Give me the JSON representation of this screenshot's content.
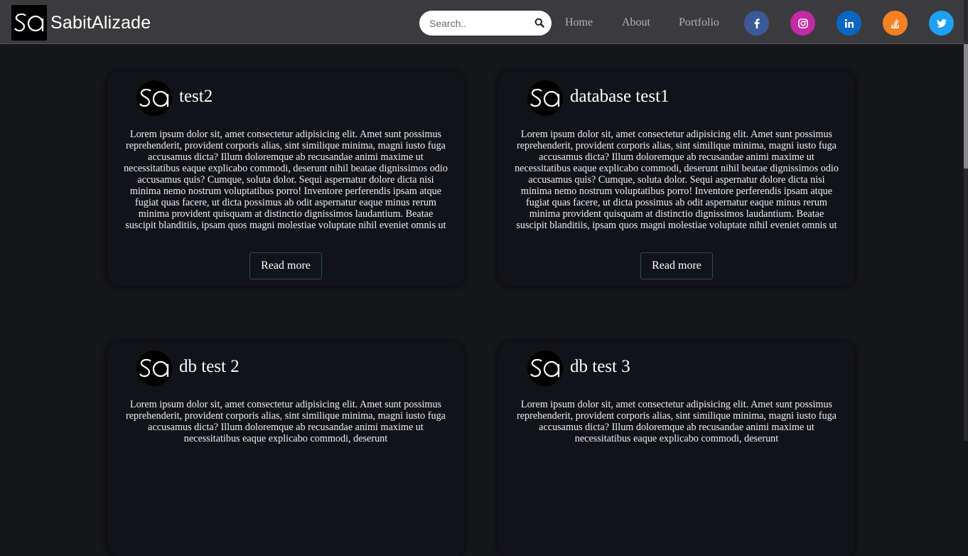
{
  "header": {
    "brand_name": "SabitAlizade",
    "logo_text": "SA",
    "search": {
      "placeholder": "Search..",
      "value": ""
    },
    "nav": [
      {
        "label": "Home"
      },
      {
        "label": "About"
      },
      {
        "label": "Portfolio"
      }
    ],
    "social": [
      {
        "name": "facebook-icon",
        "color": "#3b5998"
      },
      {
        "name": "instagram-icon",
        "color": "#c32aa3"
      },
      {
        "name": "linkedin-icon",
        "color": "#0a66c2"
      },
      {
        "name": "stackoverflow-icon",
        "color": "#f48024"
      },
      {
        "name": "twitter-icon",
        "color": "#1da1f2"
      }
    ]
  },
  "posts": [
    {
      "title": "test2",
      "body": "Lorem ipsum dolor sit, amet consectetur adipisicing elit. Amet sunt possimus reprehenderit, provident corporis alias, sint similique minima, magni iusto fuga accusamus dicta? Illum doloremque ab recusandae animi maxime ut necessitatibus eaque explicabo commodi, deserunt nihil beatae dignissimos odio accusamus quis? Cumque, soluta dolor. Sequi aspernatur dolore dicta nisi minima nemo nostrum voluptatibus porro! Inventore perferendis ipsam atque fugiat quas facere, ut dicta possimus ab odit aspernatur eaque minus rerum minima provident quisquam at distinctio dignissimos laudantium. Beatae suscipit blanditiis, ipsam quos magni molestiae voluptate nihil eveniet omnis ut",
      "button": "Read more"
    },
    {
      "title": "database test1",
      "body": "Lorem ipsum dolor sit, amet consectetur adipisicing elit. Amet sunt possimus reprehenderit, provident corporis alias, sint similique minima, magni iusto fuga accusamus dicta? Illum doloremque ab recusandae animi maxime ut necessitatibus eaque explicabo commodi, deserunt nihil beatae dignissimos odio accusamus quis? Cumque, soluta dolor. Sequi aspernatur dolore dicta nisi minima nemo nostrum voluptatibus porro! Inventore perferendis ipsam atque fugiat quas facere, ut dicta possimus ab odit aspernatur eaque minus rerum minima provident quisquam at distinctio dignissimos laudantium. Beatae suscipit blanditiis, ipsam quos magni molestiae voluptate nihil eveniet omnis ut",
      "button": "Read more"
    },
    {
      "title": "db test 2",
      "body": "Lorem ipsum dolor sit, amet consectetur adipisicing elit. Amet sunt possimus reprehenderit, provident corporis alias, sint similique minima, magni iusto fuga accusamus dicta? Illum doloremque ab recusandae animi maxime ut necessitatibus eaque explicabo commodi, deserunt"
    },
    {
      "title": "db test 3",
      "body": "Lorem ipsum dolor sit, amet consectetur adipisicing elit. Amet sunt possimus reprehenderit, provident corporis alias, sint similique minima, magni iusto fuga accusamus dicta? Illum doloremque ab recusandae animi maxime ut necessitatibus eaque explicabo commodi, deserunt"
    }
  ]
}
